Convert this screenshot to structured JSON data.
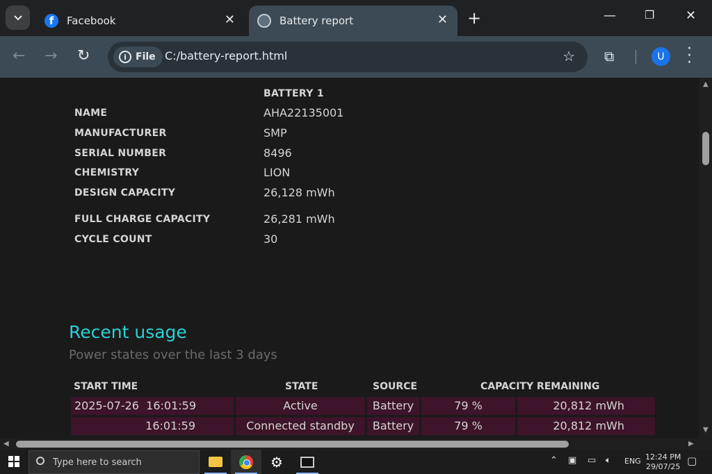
{
  "browser": {
    "tabs": [
      {
        "title": "Facebook",
        "icon": "facebook-icon"
      },
      {
        "title": "Battery report",
        "icon": "globe-icon"
      }
    ],
    "new_tab": "+",
    "address": {
      "scheme_chip": "File",
      "url": "C:/battery-report.html"
    },
    "avatar_letter": "U"
  },
  "battery": {
    "column_header": "BATTERY 1",
    "rows": [
      {
        "label": "NAME",
        "value": "AHA22135001"
      },
      {
        "label": "MANUFACTURER",
        "value": "SMP"
      },
      {
        "label": "SERIAL NUMBER",
        "value": "8496"
      },
      {
        "label": "CHEMISTRY",
        "value": "LION"
      },
      {
        "label": "DESIGN CAPACITY",
        "value": "26,128 mWh"
      },
      {
        "label": "FULL CHARGE CAPACITY",
        "value": "26,281 mWh"
      },
      {
        "label": "CYCLE COUNT",
        "value": "30"
      }
    ]
  },
  "recent_usage": {
    "title": "Recent usage",
    "subtitle": "Power states over the last 3 days",
    "headers": {
      "start_time": "START TIME",
      "state": "STATE",
      "source": "SOURCE",
      "capacity": "CAPACITY REMAINING"
    },
    "rows": [
      {
        "date": "2025-07-26",
        "time": "16:01:59",
        "state": "Active",
        "source": "Battery",
        "percent": "79 %",
        "mwh": "20,812 mWh"
      },
      {
        "date": "",
        "time": "16:01:59",
        "state": "Connected standby",
        "source": "Battery",
        "percent": "79 %",
        "mwh": "20,812 mWh"
      }
    ]
  },
  "taskbar": {
    "search_placeholder": "Type here to search",
    "language": "ENG",
    "time": "12:24 PM",
    "date": "29/07/25"
  },
  "colors": {
    "accent_heading": "#2ad1d4",
    "row_highlight": "#3d1429",
    "toolbar": "#3c4a55"
  }
}
